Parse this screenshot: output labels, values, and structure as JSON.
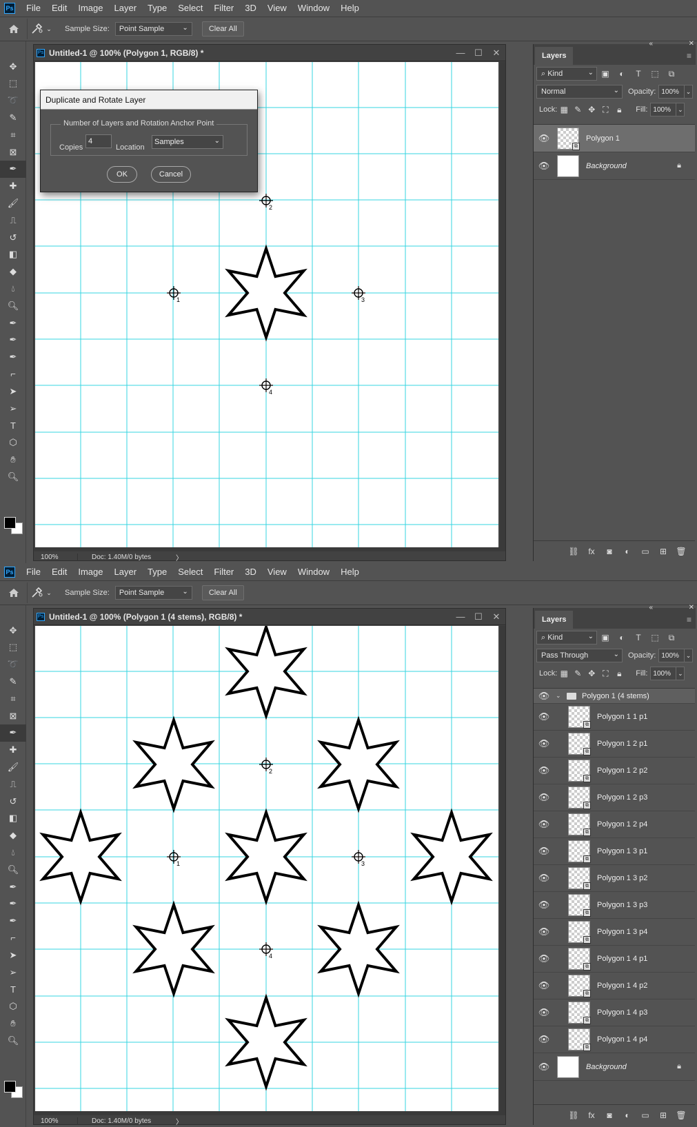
{
  "menu": [
    "File",
    "Edit",
    "Image",
    "Layer",
    "Type",
    "Select",
    "Filter",
    "3D",
    "View",
    "Window",
    "Help"
  ],
  "logo": "Ps",
  "options": {
    "sample_size_label": "Sample Size:",
    "sample_size_value": "Point Sample",
    "clear_all": "Clear All"
  },
  "colors": {
    "guide": "#35d4e0",
    "accent": "#31a8ff",
    "ui_bg": "#535353"
  },
  "screen1": {
    "doc_title": "Untitled-1 @ 100% (Polygon 1, RGB/8) *",
    "status_zoom": "100%",
    "status_doc": "Doc: 1.40M/0 bytes",
    "status_arrow": "〉",
    "dialog": {
      "title": "Duplicate and Rotate Layer",
      "legend": "Number of Layers and Rotation Anchor Point",
      "copies_label": "Copies",
      "copies_value": "4",
      "location_label": "Location",
      "location_value": "Samples",
      "ok": "OK",
      "cancel": "Cancel"
    },
    "panel": {
      "tab": "Layers",
      "kind": "Kind",
      "blend": "Normal",
      "opacity_label": "Opacity:",
      "opacity": "100%",
      "lock_label": "Lock:",
      "fill_label": "Fill:",
      "fill": "100%",
      "layers": [
        {
          "name": "Polygon 1",
          "selected": true
        },
        {
          "name": "Background"
        }
      ]
    },
    "samplers": [
      "1",
      "2",
      "3",
      "4"
    ]
  },
  "screen2": {
    "doc_title": "Untitled-1 @ 100% (Polygon 1 (4 stems), RGB/8) *",
    "status_zoom": "100%",
    "status_doc": "Doc: 1.40M/0 bytes",
    "status_arrow": "〉",
    "panel": {
      "tab": "Layers",
      "kind": "Kind",
      "blend": "Pass Through",
      "opacity_label": "Opacity:",
      "opacity": "100%",
      "lock_label": "Lock:",
      "fill_label": "Fill:",
      "fill": "100%",
      "group": "Polygon 1 (4 stems)",
      "layers": [
        "Polygon 1 1 p1",
        "Polygon 1 2 p1",
        "Polygon 1 2 p2",
        "Polygon 1 2 p3",
        "Polygon 1 2 p4",
        "Polygon 1 3 p1",
        "Polygon 1 3 p2",
        "Polygon 1 3 p3",
        "Polygon 1 3 p4",
        "Polygon 1 4 p1",
        "Polygon 1 4 p2",
        "Polygon 1 4 p3",
        "Polygon 1 4 p4"
      ],
      "background": "Background"
    },
    "samplers": [
      "1",
      "2",
      "3",
      "4"
    ]
  }
}
